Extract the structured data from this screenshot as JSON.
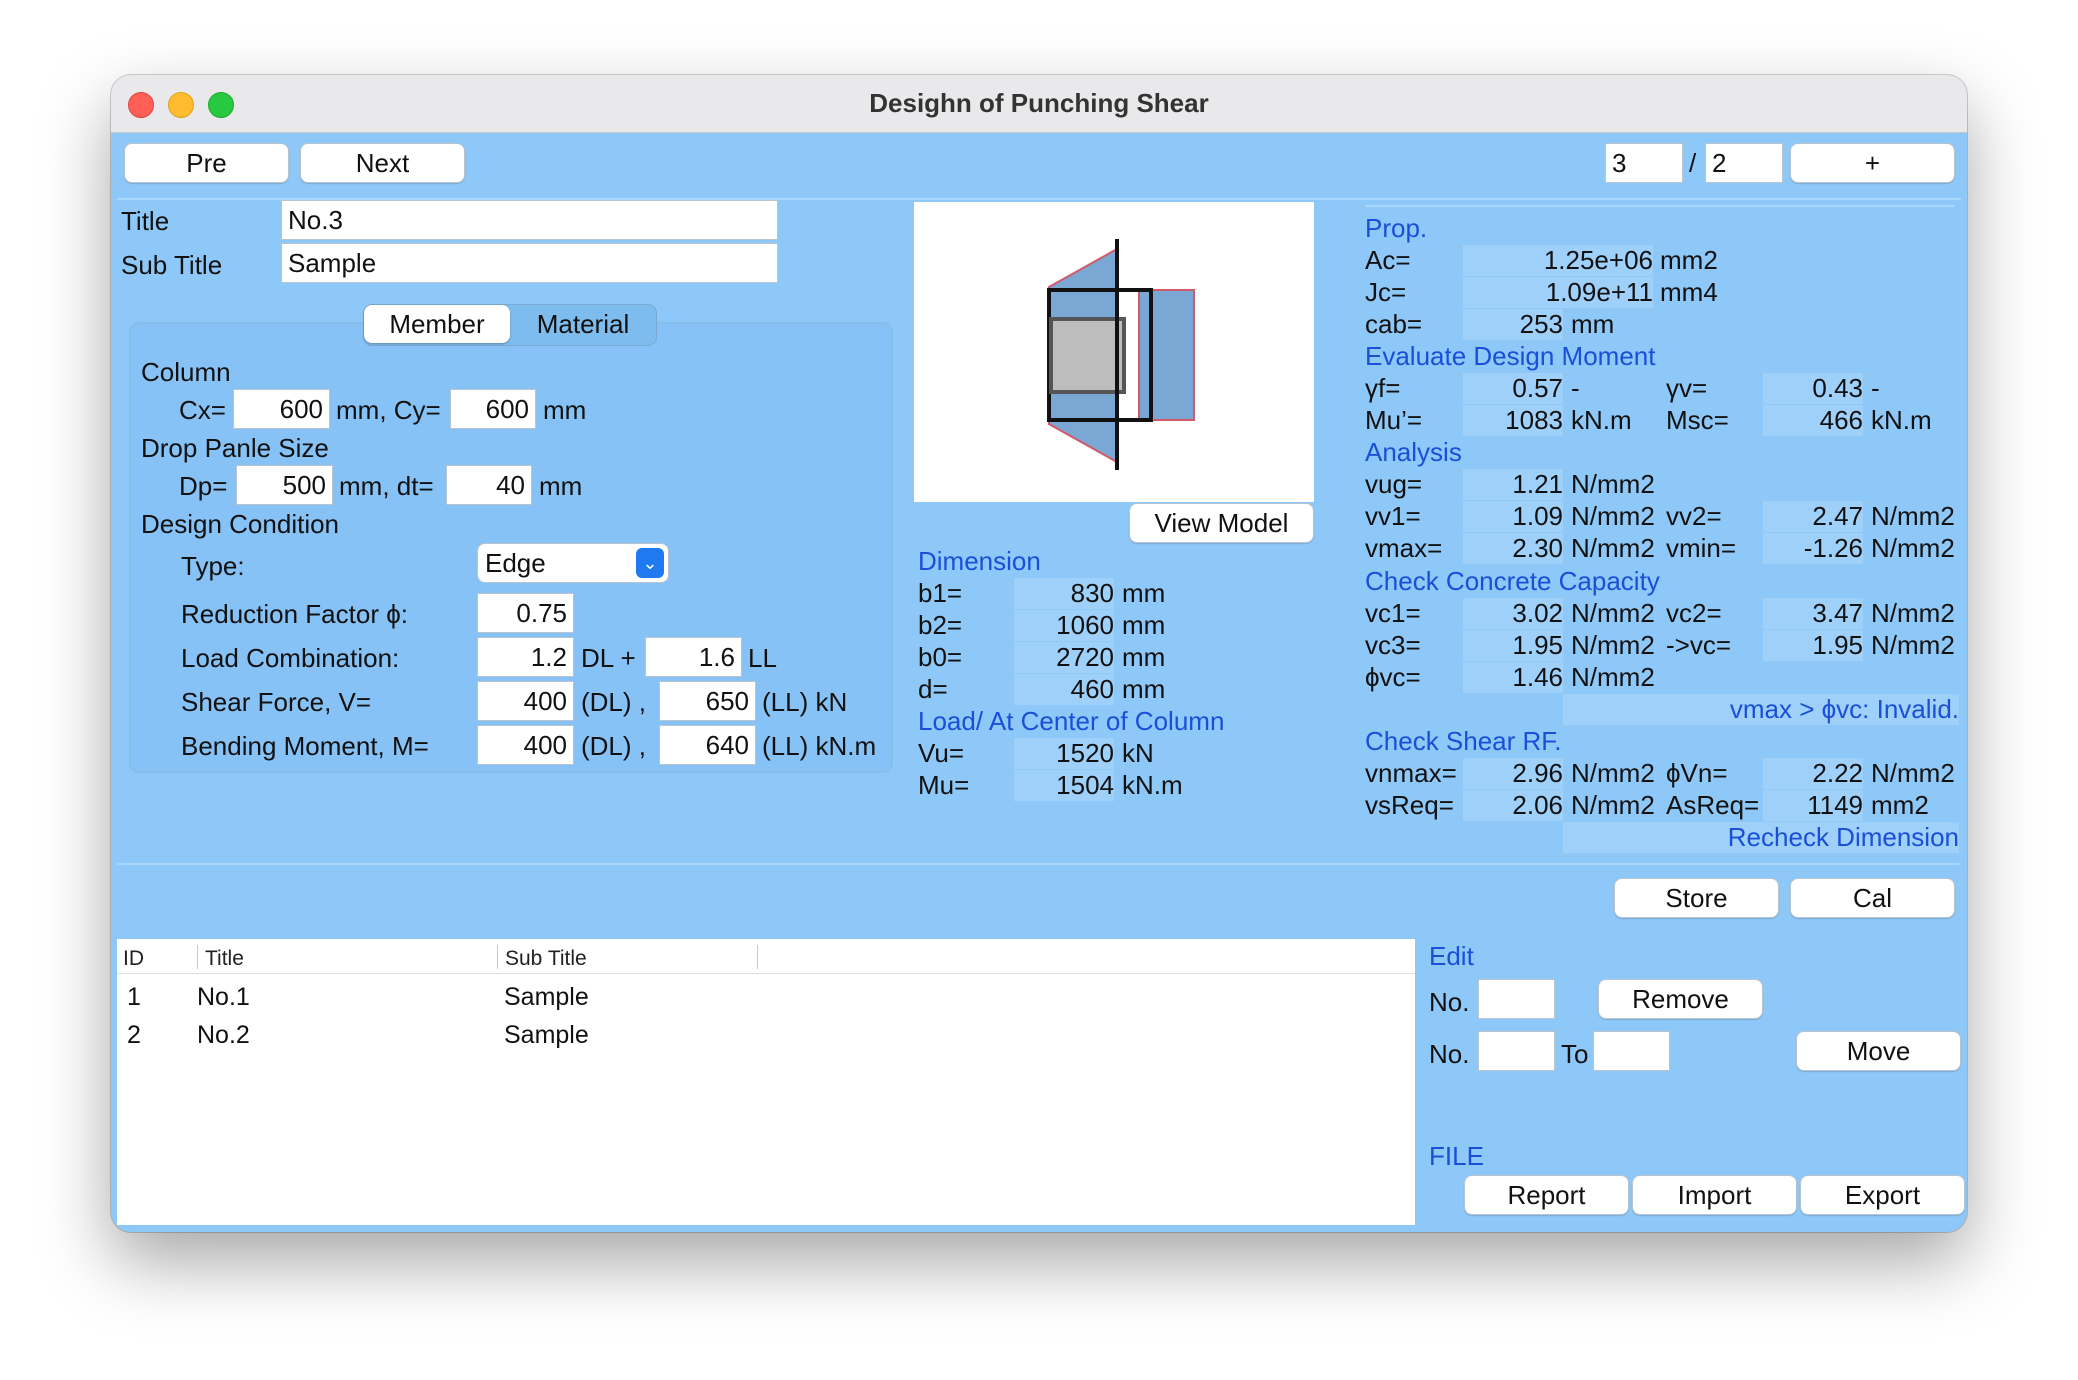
{
  "window": {
    "title": "Desighn of Punching Shear"
  },
  "nav": {
    "pre": "Pre",
    "next": "Next",
    "page_current": "3",
    "page_sep": "/",
    "page_total": "2",
    "add": "+"
  },
  "form": {
    "title_label": "Title",
    "title_value": "No.3",
    "subtitle_label": "Sub Title",
    "subtitle_value": "Sample"
  },
  "tabs": {
    "member": "Member",
    "material": "Material"
  },
  "member": {
    "column_heading": "Column",
    "cx_label": "Cx=",
    "cx_value": "600",
    "cx_unit": "mm, Cy=",
    "cy_value": "600",
    "cy_unit": "mm",
    "drop_heading": "Drop Panle Size",
    "dp_label": "Dp=",
    "dp_value": "500",
    "dp_unit": "mm, dt=",
    "dt_value": "40",
    "dt_unit": "mm",
    "design_heading": "Design Condition",
    "type_label": "Type:",
    "type_value": "Edge",
    "reduction_label": "Reduction Factor ϕ:",
    "reduction_value": "0.75",
    "load_label": "Load Combination:",
    "load_dl_value": "1.2",
    "load_dl_unit": "DL +",
    "load_ll_value": "1.6",
    "load_ll_unit": "LL",
    "shear_label": "Shear Force, V=",
    "shear_dl_value": "400",
    "shear_dl_unit": "(DL) ,",
    "shear_ll_value": "650",
    "shear_ll_unit": "(LL) kN",
    "moment_label": "Bending Moment, M=",
    "moment_dl_value": "400",
    "moment_dl_unit": "(DL) ,",
    "moment_ll_value": "640",
    "moment_ll_unit": "(LL) kN.m"
  },
  "model": {
    "view_button": "View Model"
  },
  "dimension": {
    "heading": "Dimension",
    "rows": [
      {
        "label": "b1=",
        "value": "830",
        "unit": "mm"
      },
      {
        "label": "b2=",
        "value": "1060",
        "unit": "mm"
      },
      {
        "label": "b0=",
        "value": "2720",
        "unit": "mm"
      },
      {
        "label": "d=",
        "value": "460",
        "unit": "mm"
      }
    ]
  },
  "load": {
    "heading": "Load/ At Center of Column",
    "rows": [
      {
        "label": "Vu=",
        "value": "1520",
        "unit": "kN"
      },
      {
        "label": "Mu=",
        "value": "1504",
        "unit": "kN.m"
      }
    ]
  },
  "prop": {
    "heading": "Prop.",
    "ac_label": "Ac=",
    "ac_value": "1.25e+06",
    "ac_unit": "mm2",
    "jc_label": "Jc=",
    "jc_value": "1.09e+11",
    "jc_unit": "mm4",
    "cab_label": "cab=",
    "cab_value": "253",
    "cab_unit": "mm"
  },
  "moment": {
    "heading": "Evaluate Design Moment",
    "yf_label": "γf=",
    "yf_value": "0.57",
    "yf_unit": "-",
    "yv_label": "γv=",
    "yv_value": "0.43",
    "yv_unit": "-",
    "mu_label": "Mu’=",
    "mu_value": "1083",
    "mu_unit": "kN.m",
    "msc_label": "Msc=",
    "msc_value": "466",
    "msc_unit": "kN.m"
  },
  "analysis": {
    "heading": "Analysis",
    "vug_label": "vug=",
    "vug_value": "1.21",
    "vug_unit": "N/mm2",
    "vv1_label": "vv1=",
    "vv1_value": "1.09",
    "vv1_unit": "N/mm2",
    "vv2_label": "vv2=",
    "vv2_value": "2.47",
    "vv2_unit": "N/mm2",
    "vmax_label": "vmax=",
    "vmax_value": "2.30",
    "vmax_unit": "N/mm2",
    "vmin_label": "vmin=",
    "vmin_value": "-1.26",
    "vmin_unit": "N/mm2"
  },
  "concrete": {
    "heading": "Check Concrete Capacity",
    "vc1_label": "vc1=",
    "vc1_value": "3.02",
    "vc1_unit": "N/mm2",
    "vc2_label": "vc2=",
    "vc2_value": "3.47",
    "vc2_unit": "N/mm2",
    "vc3_label": "vc3=",
    "vc3_value": "1.95",
    "vc3_unit": "N/mm2",
    "vc_label": "->vc=",
    "vc_value": "1.95",
    "vc_unit": "N/mm2",
    "phivc_label": "ϕvc=",
    "phivc_value": "1.46",
    "phivc_unit": "N/mm2",
    "status": "vmax > ϕvc: Invalid."
  },
  "shear_rf": {
    "heading": "Check Shear RF.",
    "vnmax_label": "vnmax=",
    "vnmax_value": "2.96",
    "vnmax_unit": "N/mm2",
    "phivn_label": "ϕVn=",
    "phivn_value": "2.22",
    "phivn_unit": "N/mm2",
    "vsreq_label": "vsReq=",
    "vsreq_value": "2.06",
    "vsreq_unit": "N/mm2",
    "asreq_label": "AsReq=",
    "asreq_value": "1149",
    "asreq_unit": "mm2",
    "status": "Recheck Dimension"
  },
  "actions": {
    "store": "Store",
    "cal": "Cal"
  },
  "table": {
    "columns": [
      "ID",
      "Title",
      "Sub Title"
    ],
    "rows": [
      {
        "id": "1",
        "title": "No.1",
        "subtitle": "Sample"
      },
      {
        "id": "2",
        "title": "No.2",
        "subtitle": "Sample"
      }
    ]
  },
  "edit": {
    "heading": "Edit",
    "no_label": "No.",
    "remove": "Remove",
    "no2_label": "No.",
    "to_label": "To",
    "move": "Move"
  },
  "file": {
    "heading": "FILE",
    "report": "Report",
    "import": "Import",
    "export": "Export"
  },
  "colors": {
    "window_bg": "#8ec8f8",
    "heading_blue": "#1a4fd8",
    "diagram_fill": "#7ba7d4",
    "diagram_edge": "#d05a6a"
  }
}
